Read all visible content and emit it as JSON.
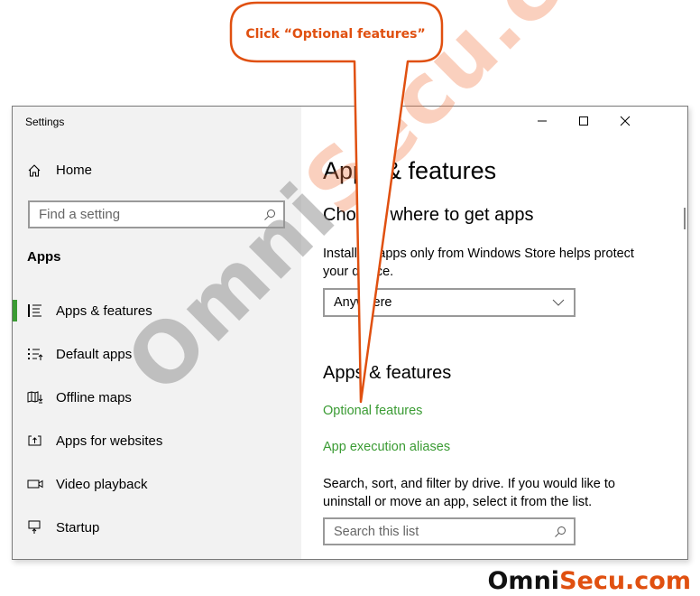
{
  "callout": {
    "text": "Click “Optional features”",
    "color": "#e05010"
  },
  "window": {
    "title": "Settings",
    "controls": {
      "minimize": "minimize-icon",
      "maximize": "maximize-icon",
      "close": "close-icon"
    }
  },
  "sidebar": {
    "home_label": "Home",
    "search_placeholder": "Find a setting",
    "section_heading": "Apps",
    "items": [
      {
        "label": "Apps & features",
        "icon": "apps-features-icon",
        "selected": true
      },
      {
        "label": "Default apps",
        "icon": "default-apps-icon",
        "selected": false
      },
      {
        "label": "Offline maps",
        "icon": "offline-maps-icon",
        "selected": false
      },
      {
        "label": "Apps for websites",
        "icon": "apps-websites-icon",
        "selected": false
      },
      {
        "label": "Video playback",
        "icon": "video-playback-icon",
        "selected": false
      },
      {
        "label": "Startup",
        "icon": "startup-icon",
        "selected": false
      }
    ]
  },
  "main": {
    "page_title": "Apps & features",
    "choose_heading": "Choose where to get apps",
    "choose_description": "Installing apps only from Windows Store helps protect your device.",
    "source_dropdown": {
      "selected": "Anywhere"
    },
    "apps_heading": "Apps & features",
    "links": [
      "Optional features",
      "App execution aliases"
    ],
    "list_description": "Search, sort, and filter by drive. If you would like to uninstall or move an app, select it from the list.",
    "list_search_placeholder": "Search this list"
  },
  "watermark": {
    "part1": "Omni",
    "part2": "Secu.com"
  },
  "brand": {
    "part1": "Omni",
    "part2": "Secu.com"
  },
  "colors": {
    "accent": "#3a9b33",
    "callout": "#e05010",
    "sidebar_bg": "#f2f2f2"
  }
}
